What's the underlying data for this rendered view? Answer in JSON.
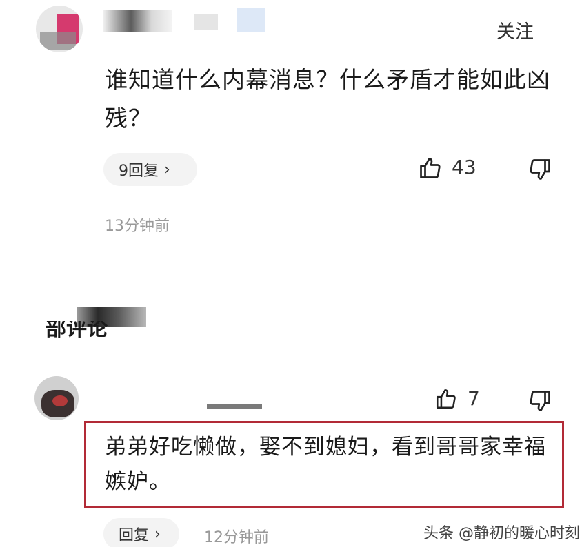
{
  "comment1": {
    "follow_label": "关注",
    "text": "谁知道什么内幕消息？什么矛盾才能如此凶残？",
    "reply_label": "9回复",
    "likes": "43",
    "time": "13分钟前"
  },
  "section": {
    "title": "部评论"
  },
  "comment2": {
    "likes": "7",
    "text": "弟弟好吃懒做，娶不到媳妇，看到哥哥家幸福嫉妒。",
    "reply_label": "回复",
    "time": "12分钟前"
  },
  "watermark": "头条 @静初的暖心时刻",
  "colors": {
    "highlight_border": "#b22a36",
    "muted_text": "#999999"
  },
  "icons": [
    "thumbs-up-icon",
    "thumbs-down-icon",
    "chevron-right-icon"
  ]
}
